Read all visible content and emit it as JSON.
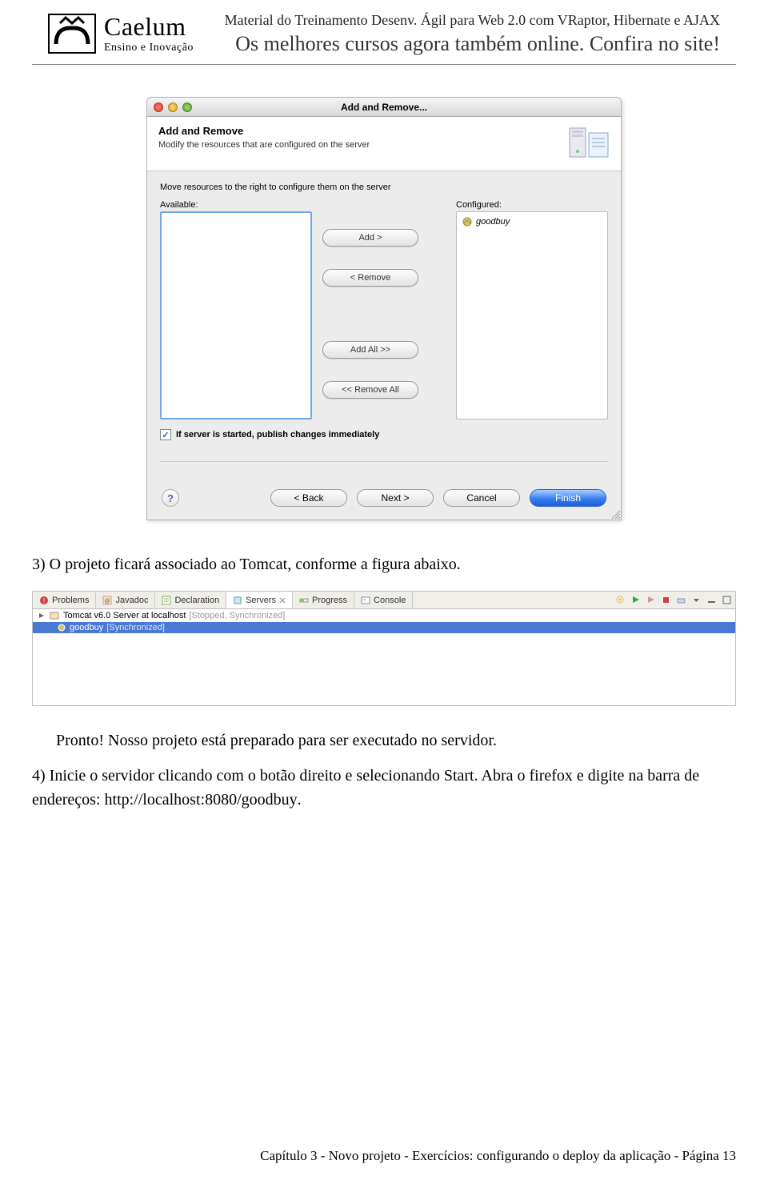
{
  "header": {
    "logo_name": "Caelum",
    "logo_tag": "Ensino e Inovação",
    "line1": "Material do Treinamento Desenv. Ágil para Web 2.0 com VRaptor, Hibernate e AJAX",
    "line2": "Os melhores cursos agora também online. Confira no site!"
  },
  "dialog": {
    "title": "Add and Remove...",
    "heading": "Add and Remove",
    "subheading": "Modify the resources that are configured on the server",
    "instruction": "Move resources to the right to configure them on the server",
    "available_label": "Available:",
    "configured_label": "Configured:",
    "configured_item": "goodbuy",
    "btn_add": "Add >",
    "btn_remove": "< Remove",
    "btn_add_all": "Add All >>",
    "btn_remove_all": "<< Remove All",
    "checkbox_label": "If server is started, publish changes immediately",
    "checkbox_checked": "✓",
    "btn_back": "< Back",
    "btn_next": "Next >",
    "btn_cancel": "Cancel",
    "btn_finish": "Finish",
    "help_label": "?"
  },
  "step3_text": "O projeto ficará associado ao Tomcat, conforme a figura abaixo.",
  "step3_num": "3)",
  "servers": {
    "tabs": {
      "problems": "Problems",
      "javadoc": "Javadoc",
      "declaration": "Declaration",
      "servers": "Servers",
      "progress": "Progress",
      "console": "Console"
    },
    "tree_root": "Tomcat v6.0 Server at localhost",
    "tree_root_status": "[Stopped, Synchronized]",
    "tree_child": "goodbuy",
    "tree_child_status": "[Synchronized]"
  },
  "pronto_text": "Pronto! Nosso projeto está preparado para ser executado no servidor.",
  "step4_num": "4)",
  "step4_text_a": "Inicie o servidor clicando com o botão direito e selecionando Start. Abra o firefox e digite na barra de endereços: ",
  "step4_url": "http://localhost:8080/goodbuy",
  "step4_text_b": ".",
  "footer": "Capítulo 3 - Novo projeto -  Exercícios: configurando o deploy da aplicação - Página 13"
}
